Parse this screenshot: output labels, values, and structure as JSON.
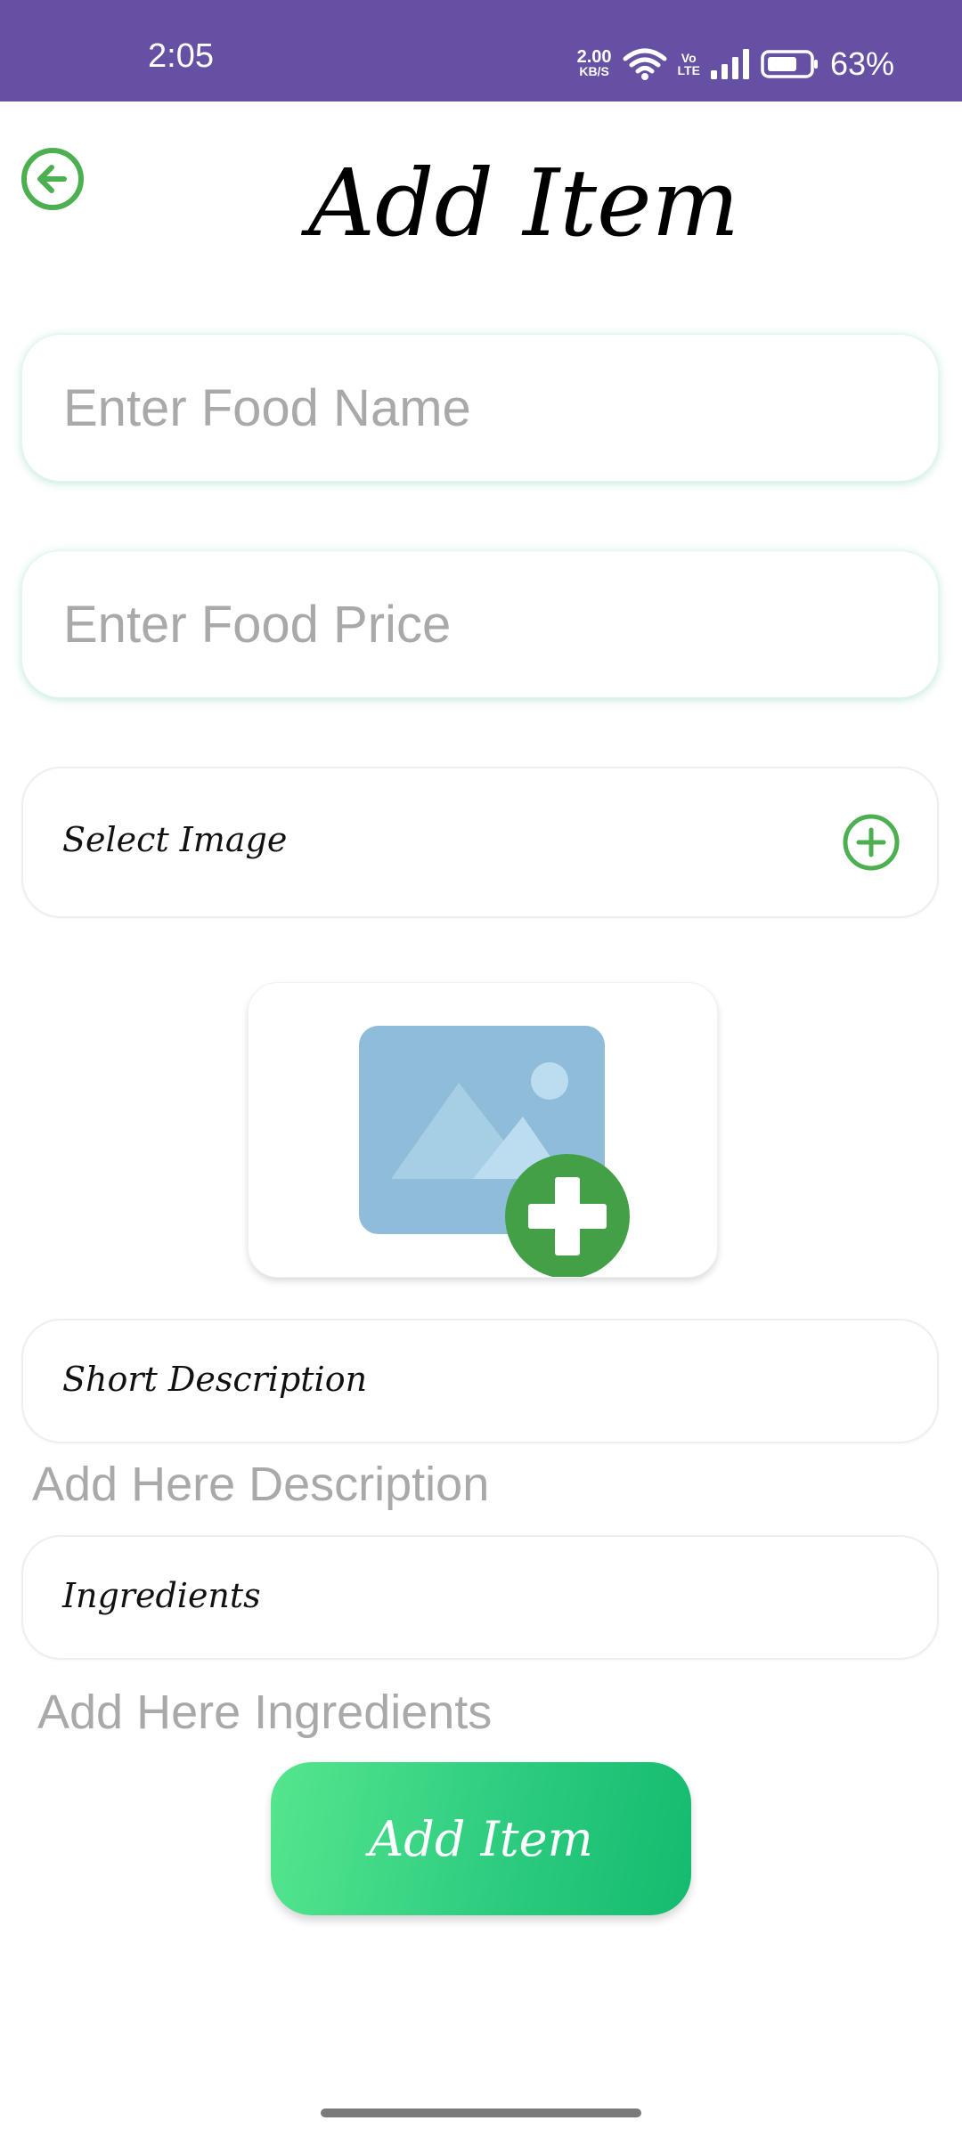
{
  "status_bar": {
    "time": "2:05",
    "net_speed_value": "2.00",
    "net_speed_unit": "KB/S",
    "volte_top": "Vo",
    "volte_bottom": "LTE",
    "battery_pct": "63%"
  },
  "header": {
    "title": "Add Item"
  },
  "form": {
    "food_name_placeholder": "Enter Food Name",
    "food_price_placeholder": "Enter Food Price",
    "select_image_label": "Select Image",
    "short_description_label": "Short Description",
    "description_placeholder": "Add Here Description",
    "ingredients_label": "Ingredients",
    "ingredients_placeholder": "Add Here Ingredients",
    "submit_label": "Add Item"
  },
  "colors": {
    "status_bar": "#6650A4",
    "accent_green": "#4CAF50",
    "image_placeholder_blue": "#8FBCD8",
    "button_gradient_start": "#55E68E",
    "button_gradient_end": "#14BB6E"
  },
  "icons": {
    "back": "arrow-left-circle-icon",
    "select_image": "plus-circle-icon",
    "image_placeholder": "image-add-icon"
  }
}
